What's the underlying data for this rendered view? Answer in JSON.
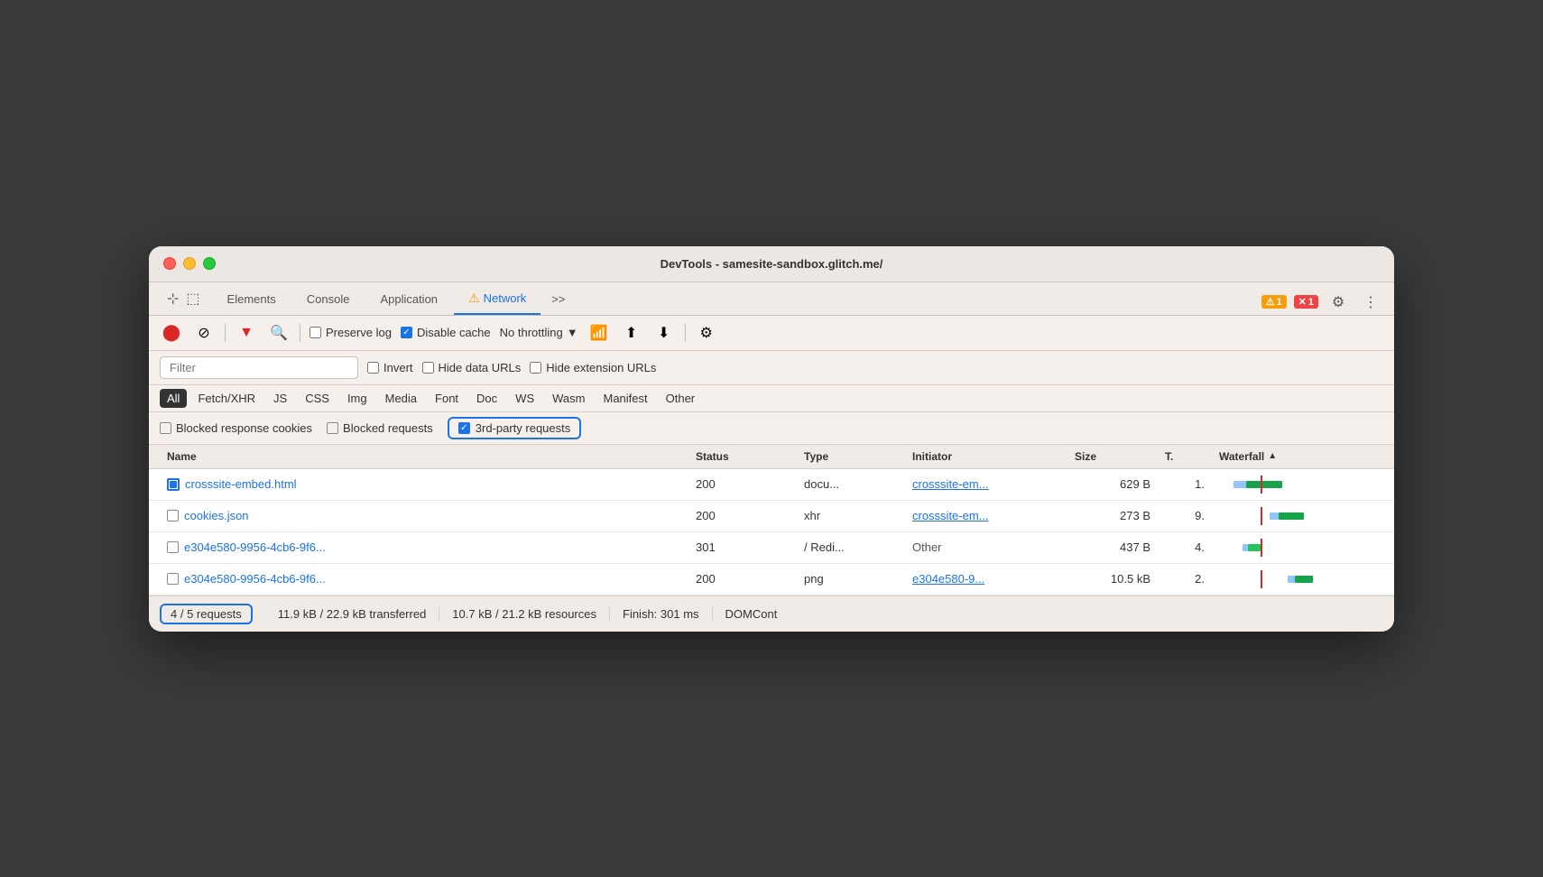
{
  "window": {
    "title": "DevTools - samesite-sandbox.glitch.me/"
  },
  "tabs": [
    {
      "label": "Elements",
      "active": false
    },
    {
      "label": "Console",
      "active": false
    },
    {
      "label": "Application",
      "active": false
    },
    {
      "label": "Network",
      "active": true,
      "has_warning": true
    },
    {
      "label": ">>",
      "active": false
    }
  ],
  "badges": {
    "warning_count": "1",
    "error_count": "1"
  },
  "network_toolbar": {
    "preserve_log": "Preserve log",
    "disable_cache": "Disable cache",
    "no_throttling": "No throttling"
  },
  "filter": {
    "placeholder": "Filter"
  },
  "filter_checkboxes": {
    "invert": "Invert",
    "hide_data_urls": "Hide data URLs",
    "hide_extension_urls": "Hide extension URLs"
  },
  "type_filters": [
    "All",
    "Fetch/XHR",
    "JS",
    "CSS",
    "Img",
    "Media",
    "Font",
    "Doc",
    "WS",
    "Wasm",
    "Manifest",
    "Other"
  ],
  "cookie_filters": {
    "blocked_response_cookies": "Blocked response cookies",
    "blocked_requests": "Blocked requests",
    "third_party_requests": "3rd-party requests"
  },
  "table": {
    "headers": [
      "Name",
      "Status",
      "Type",
      "Initiator",
      "Size",
      "T.",
      "Waterfall"
    ],
    "rows": [
      {
        "name": "crosssite-embed.html",
        "status": "200",
        "type": "docu...",
        "initiator": "crosssite-em...",
        "size": "629 B",
        "time": "1.",
        "has_doc_icon": true
      },
      {
        "name": "cookies.json",
        "status": "200",
        "type": "xhr",
        "initiator": "crosssite-em...",
        "size": "273 B",
        "time": "9.",
        "has_doc_icon": false
      },
      {
        "name": "e304e580-9956-4cb6-9f6...",
        "status": "301",
        "type": "/ Redi...",
        "initiator": "Other",
        "size": "437 B",
        "time": "4.",
        "has_doc_icon": false
      },
      {
        "name": "e304e580-9956-4cb6-9f6...",
        "status": "200",
        "type": "png",
        "initiator": "e304e580-9...",
        "size": "10.5 kB",
        "time": "2.",
        "has_doc_icon": false
      }
    ]
  },
  "status_bar": {
    "requests": "4 / 5 requests",
    "transferred": "11.9 kB / 22.9 kB transferred",
    "resources": "10.7 kB / 21.2 kB resources",
    "finish": "Finish: 301 ms",
    "dom_content": "DOMCont"
  }
}
